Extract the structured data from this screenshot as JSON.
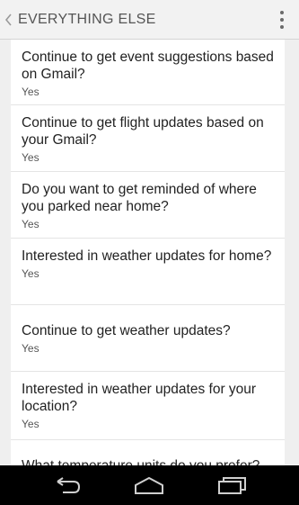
{
  "header": {
    "title": "EVERYTHING ELSE",
    "back_icon": "chevron-left-icon",
    "menu_icon": "overflow-menu-icon"
  },
  "settings": [
    {
      "question": "Continue to get event suggestions based on Gmail?",
      "answer": "Yes"
    },
    {
      "question": "Continue to get flight updates based on your Gmail?",
      "answer": "Yes"
    },
    {
      "question": "Do you want to get reminded of where you parked near home?",
      "answer": "Yes"
    },
    {
      "question": "Interested in weather updates for home?",
      "answer": "Yes"
    },
    {
      "question": "Continue to get weather updates?",
      "answer": "Yes"
    },
    {
      "question": "Interested in weather updates for your location?",
      "answer": "Yes"
    },
    {
      "question": "What temperature units do you prefer?",
      "answer": ""
    }
  ],
  "navbar": {
    "icons": [
      "back-icon",
      "home-icon",
      "recent-apps-icon"
    ]
  }
}
